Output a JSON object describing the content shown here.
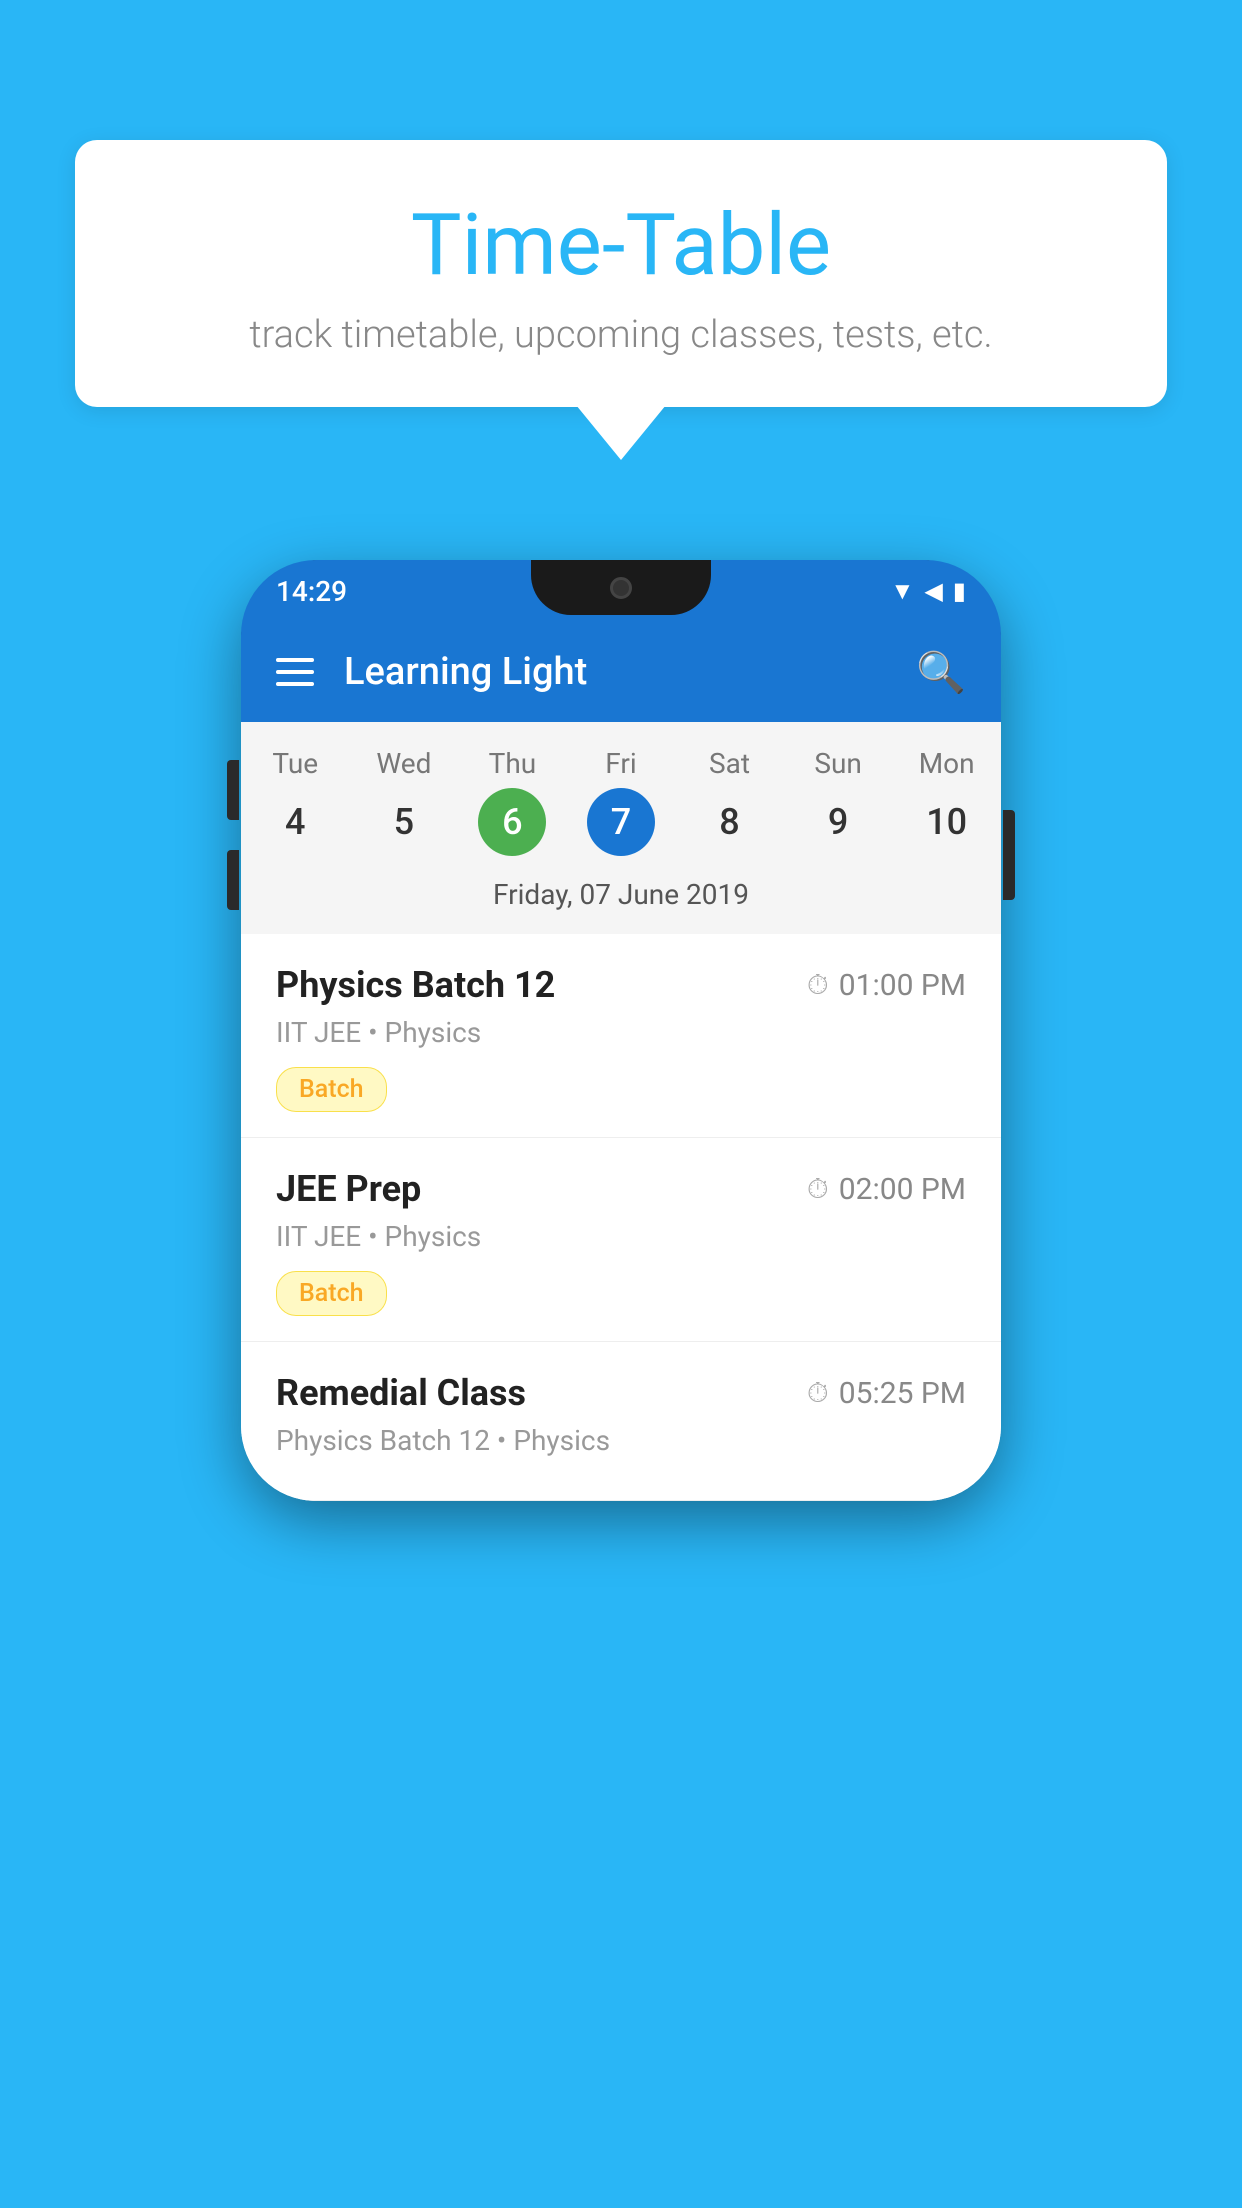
{
  "background_color": "#29B6F6",
  "speech_bubble": {
    "title": "Time-Table",
    "subtitle": "track timetable, upcoming classes, tests, etc."
  },
  "phone": {
    "status_bar": {
      "time": "14:29"
    },
    "app_bar": {
      "title": "Learning Light"
    },
    "calendar": {
      "days": [
        {
          "label": "Tue",
          "number": "4"
        },
        {
          "label": "Wed",
          "number": "5"
        },
        {
          "label": "Thu",
          "number": "6",
          "state": "today"
        },
        {
          "label": "Fri",
          "number": "7",
          "state": "selected"
        },
        {
          "label": "Sat",
          "number": "8"
        },
        {
          "label": "Sun",
          "number": "9"
        },
        {
          "label": "Mon",
          "number": "10"
        }
      ],
      "selected_date": "Friday, 07 June 2019"
    },
    "schedule": [
      {
        "title": "Physics Batch 12",
        "time": "01:00 PM",
        "subtitle": "IIT JEE • Physics",
        "tag": "Batch"
      },
      {
        "title": "JEE Prep",
        "time": "02:00 PM",
        "subtitle": "IIT JEE • Physics",
        "tag": "Batch"
      },
      {
        "title": "Remedial Class",
        "time": "05:25 PM",
        "subtitle": "Physics Batch 12 • Physics",
        "tag": ""
      }
    ]
  }
}
